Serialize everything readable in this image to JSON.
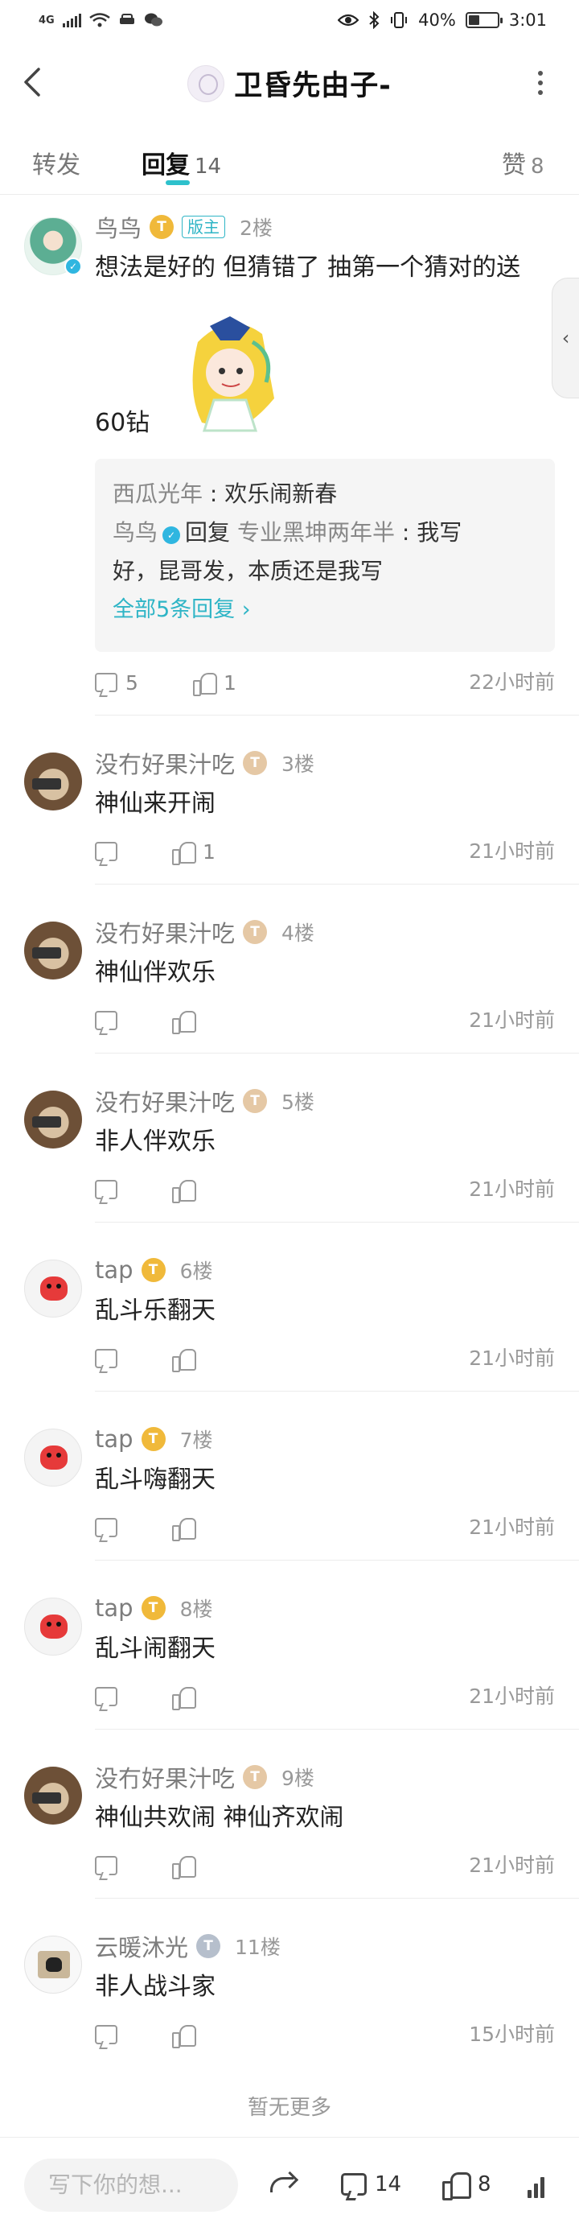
{
  "status_bar": {
    "network": "4G",
    "battery": "40%",
    "battery_level": 0.4,
    "time": "3:01"
  },
  "header": {
    "title": "卫昏先由子-"
  },
  "tabs": [
    {
      "label": "转发",
      "count": ""
    },
    {
      "label": "回复",
      "count": "14"
    },
    {
      "label": "赞",
      "count": "8"
    }
  ],
  "comments": [
    {
      "user": "鸟鸟",
      "level": "T",
      "badge": "版主",
      "floor": "2楼",
      "text_line1": "想法是好的 但猜错了 抽第一个猜对的送",
      "text_line2": "60钻",
      "sub_replies": [
        {
          "user": "西瓜光年",
          "text": "欢乐闹新春"
        },
        {
          "user": "鸟鸟",
          "reply_word": "回复",
          "target": "专业黑坤两年半",
          "text_line1": "我写",
          "text_line2": "好，昆哥发，本质还是我写"
        }
      ],
      "more_replies": "全部5条回复",
      "comment_count": "5",
      "like_count": "1",
      "time": "22小时前"
    },
    {
      "user": "没冇好果汁吃",
      "level": "T",
      "floor": "3楼",
      "text": "神仙来开闹",
      "like_count": "1",
      "time": "21小时前"
    },
    {
      "user": "没冇好果汁吃",
      "level": "T",
      "floor": "4楼",
      "text": "神仙伴欢乐",
      "like_count": "",
      "time": "21小时前"
    },
    {
      "user": "没冇好果汁吃",
      "level": "T",
      "floor": "5楼",
      "text": "非人伴欢乐",
      "like_count": "",
      "time": "21小时前"
    },
    {
      "user": "tap",
      "level": "T",
      "floor": "6楼",
      "text": "乱斗乐翻天",
      "like_count": "",
      "time": "21小时前"
    },
    {
      "user": "tap",
      "level": "T",
      "floor": "7楼",
      "text": "乱斗嗨翻天",
      "like_count": "",
      "time": "21小时前"
    },
    {
      "user": "tap",
      "level": "T",
      "floor": "8楼",
      "text": "乱斗闹翻天",
      "like_count": "",
      "time": "21小时前"
    },
    {
      "user": "没冇好果汁吃",
      "level": "T",
      "floor": "9楼",
      "text": "神仙共欢闹 神仙齐欢闹",
      "like_count": "",
      "time": "21小时前"
    },
    {
      "user": "云暖沐光",
      "level": "T",
      "floor": "11楼",
      "text": "非人战斗家",
      "like_count": "",
      "time": "15小时前"
    }
  ],
  "no_more": "暂无更多",
  "bottom_bar": {
    "input_placeholder": "写下你的想...",
    "comment_count": "14",
    "like_count": "8"
  },
  "colors": {
    "accent": "#2ec1cc",
    "moderator": "#2fb5c6",
    "level_gold": "#f0b93a",
    "level_tan": "#e5c8a5",
    "level_grey": "#b6bfcc"
  },
  "icons": [
    "back-icon",
    "more-icon",
    "comment-icon",
    "like-icon",
    "share-icon",
    "stats-icon",
    "verified-icon",
    "side-handle-icon"
  ]
}
